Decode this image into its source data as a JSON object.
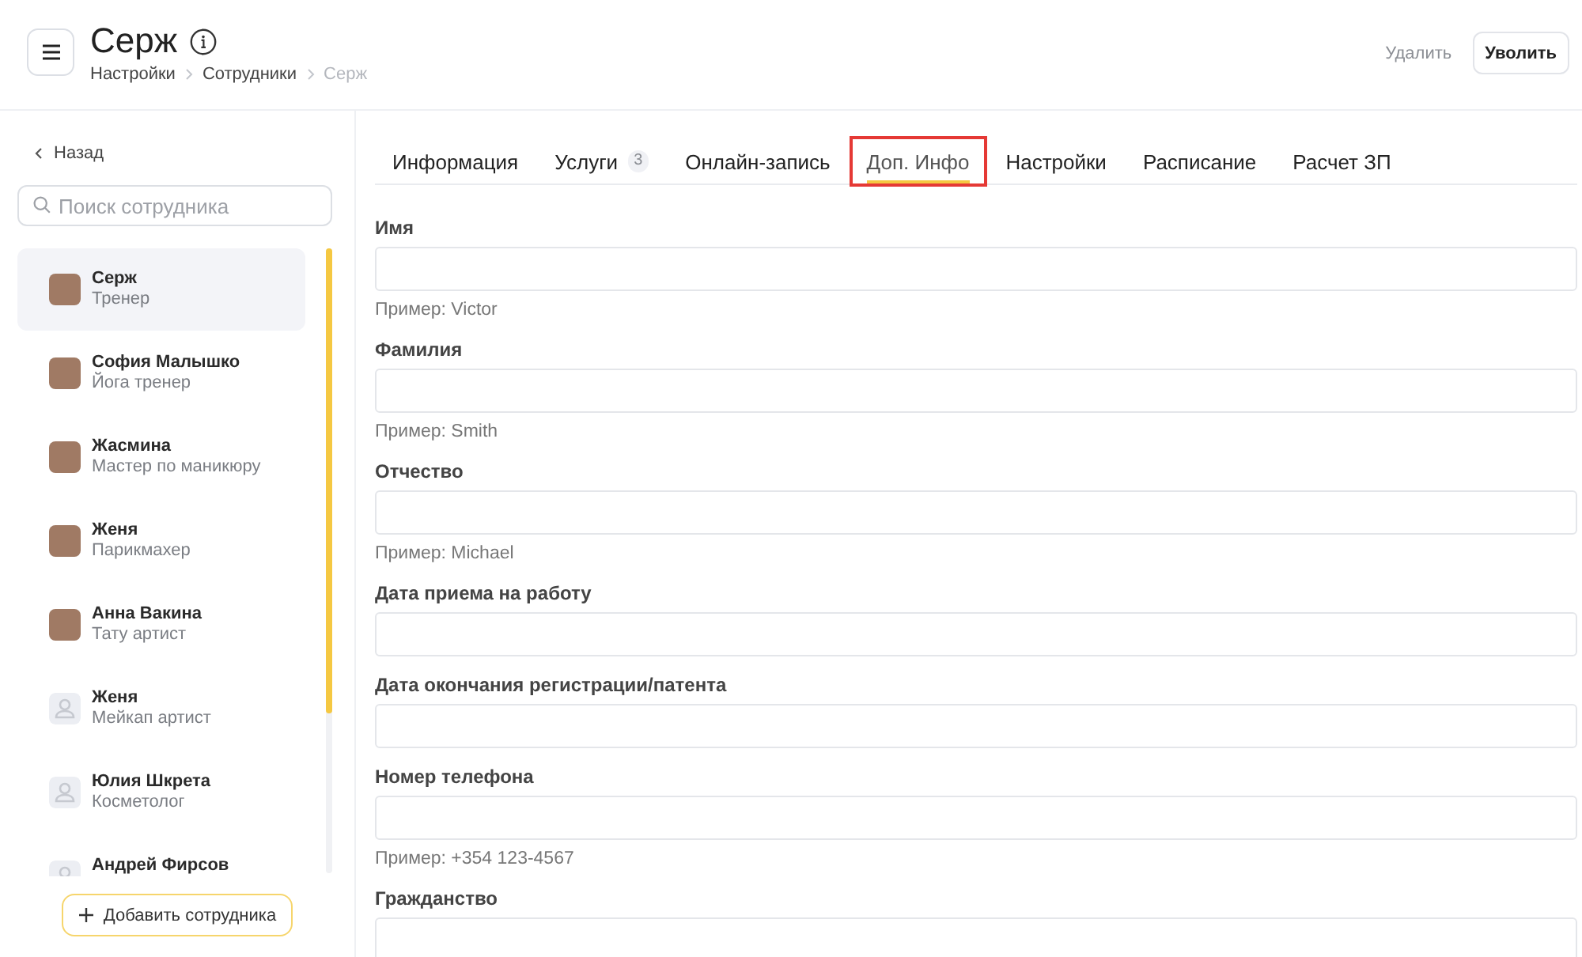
{
  "header": {
    "title": "Серж",
    "breadcrumbs": [
      {
        "label": "Настройки",
        "current": false
      },
      {
        "label": "Сотрудники",
        "current": false
      },
      {
        "label": "Серж",
        "current": true
      }
    ],
    "actions": [
      {
        "label": "Удалить",
        "kind": "link"
      },
      {
        "label": "Уволить",
        "kind": "button"
      }
    ]
  },
  "sidebar": {
    "back": "Назад",
    "search": {
      "placeholder": "Поиск сотрудника"
    },
    "employees": [
      {
        "name": "Серж",
        "role": "Тренер",
        "kind": "photo",
        "selected": true
      },
      {
        "name": "София Малышко",
        "role": "Йога тренер",
        "kind": "photo",
        "selected": false
      },
      {
        "name": "Жасмина",
        "role": "Мастер по маникюру",
        "kind": "photo",
        "selected": false
      },
      {
        "name": "Женя",
        "role": "Парикмахер",
        "kind": "photo",
        "selected": false
      },
      {
        "name": "Анна Вакина",
        "role": "Тату артист",
        "kind": "photo",
        "selected": false
      },
      {
        "name": "Женя",
        "role": "Мейкап артист",
        "kind": "generic",
        "selected": false
      },
      {
        "name": "Юлия Шкрета",
        "role": "Косметолог",
        "kind": "generic",
        "selected": false
      },
      {
        "name": "Андрей Фирсов",
        "kind": "generic",
        "selected": false
      }
    ],
    "add_button": "Добавить сотрудника"
  },
  "tabs": [
    {
      "label": "Информация",
      "selected": false,
      "highlighted": false
    },
    {
      "label": "Услуги",
      "count": "3",
      "selected": false,
      "highlighted": false
    },
    {
      "label": "Онлайн-запись",
      "selected": false,
      "highlighted": false
    },
    {
      "label": "Доп. Инфо",
      "selected": true,
      "highlighted": true
    },
    {
      "label": "Настройки",
      "selected": false,
      "highlighted": false
    },
    {
      "label": "Расписание",
      "selected": false,
      "highlighted": false
    },
    {
      "label": "Расчет ЗП",
      "selected": false,
      "highlighted": false
    }
  ],
  "form": {
    "fields": [
      {
        "label": "Имя",
        "hint": "Пример: Victor"
      },
      {
        "label": "Фамилия",
        "hint": "Пример: Smith"
      },
      {
        "label": "Отчество",
        "hint": "Пример: Michael"
      },
      {
        "label": "Дата приема на работу"
      },
      {
        "label": "Дата окончания регистрации/патента"
      },
      {
        "label": "Номер телефона",
        "hint": "Пример: +354 123-4567"
      },
      {
        "label": "Гражданство"
      }
    ]
  }
}
